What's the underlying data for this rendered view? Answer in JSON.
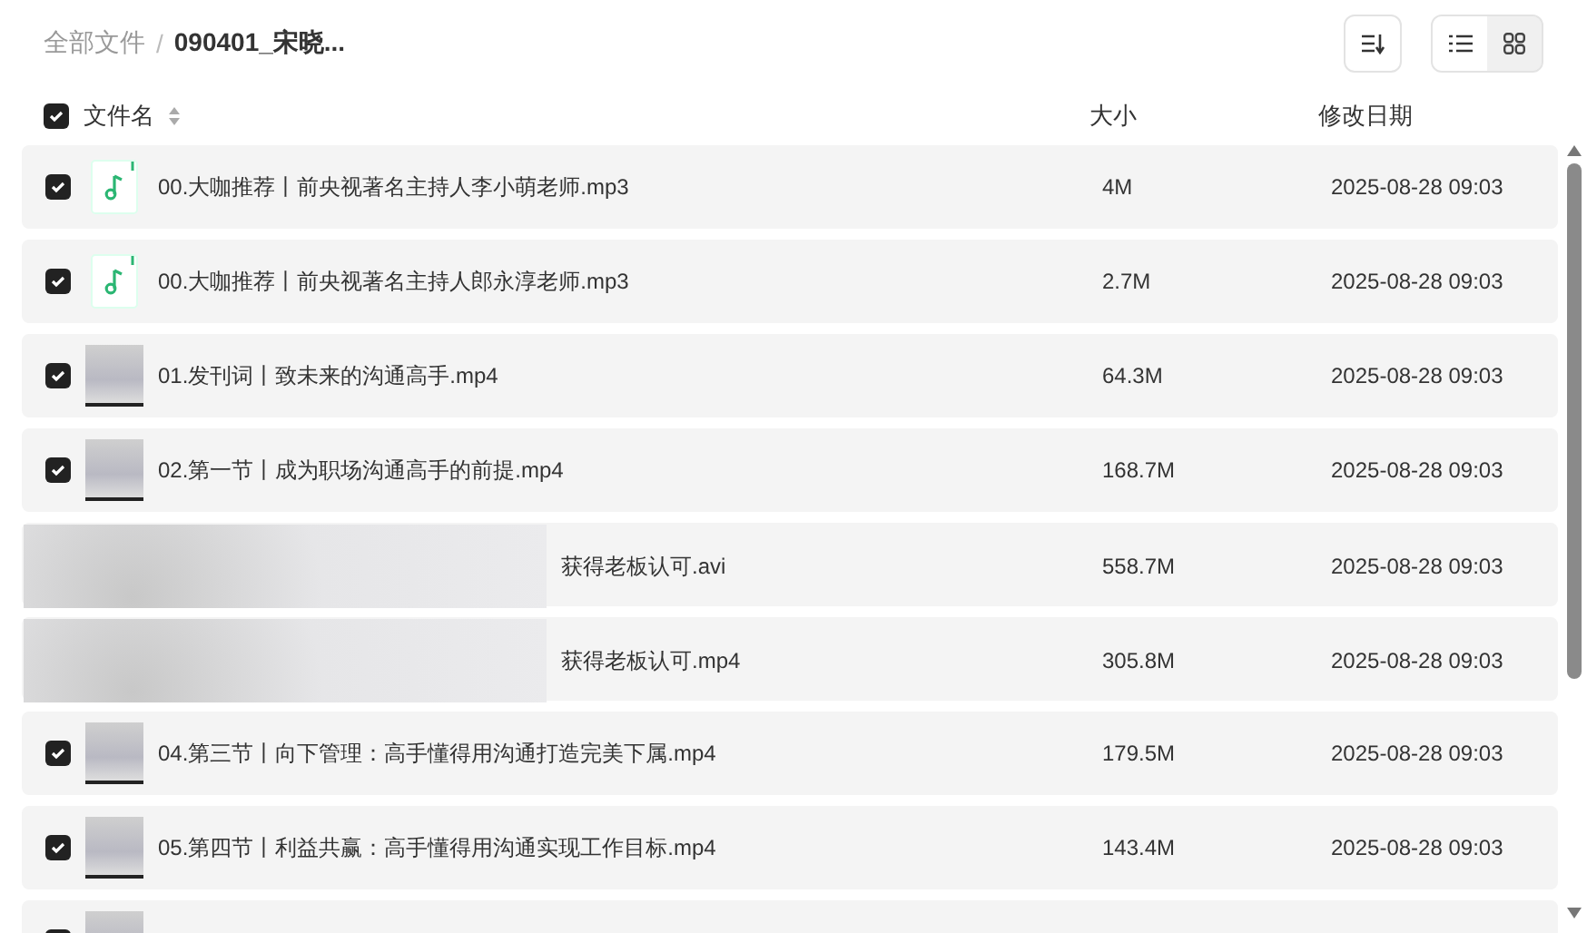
{
  "breadcrumb": [
    {
      "label": "全部文件",
      "current": false
    },
    {
      "label": "090401_宋晓...",
      "current": true
    }
  ],
  "breadcrumb_separator": "/",
  "view_modes": [
    {
      "kind": "list",
      "selected": true
    },
    {
      "kind": "grid",
      "selected": false
    }
  ],
  "table": {
    "select_all_checked": true,
    "columns": [
      "文件名",
      "大小",
      "修改日期"
    ],
    "rows": [
      {
        "kind": "audio",
        "checked": true,
        "obscured": false,
        "name": "00.大咖推荐丨前央视著名主持人李小萌老师.mp3",
        "size": "4M",
        "date": "2025-08-28 09:03"
      },
      {
        "kind": "audio",
        "checked": true,
        "obscured": false,
        "name": "00.大咖推荐丨前央视著名主持人郎永淳老师.mp3",
        "size": "2.7M",
        "date": "2025-08-28 09:03"
      },
      {
        "kind": "video",
        "checked": true,
        "obscured": false,
        "name": "01.发刊词丨致未来的沟通高手.mp4",
        "size": "64.3M",
        "date": "2025-08-28 09:03"
      },
      {
        "kind": "video",
        "checked": true,
        "obscured": false,
        "name": "02.第一节丨成为职场沟通高手的前提.mp4",
        "size": "168.7M",
        "date": "2025-08-28 09:03"
      },
      {
        "obscured": true,
        "name": "获得老板认可.avi",
        "size": "558.7M",
        "date": "2025-08-28 09:03"
      },
      {
        "obscured": true,
        "name": "获得老板认可.mp4",
        "size": "305.8M",
        "date": "2025-08-28 09:03"
      },
      {
        "kind": "video",
        "checked": true,
        "obscured": false,
        "name": "04.第三节丨向下管理：高手懂得用沟通打造完美下属.mp4",
        "size": "179.5M",
        "date": "2025-08-28 09:03"
      },
      {
        "kind": "video",
        "checked": true,
        "obscured": false,
        "name": "05.第四节丨利益共赢：高手懂得用沟通实现工作目标.mp4",
        "size": "143.4M",
        "date": "2025-08-28 09:03"
      },
      {
        "kind": "video",
        "checked": true,
        "obscured": false
      }
    ]
  }
}
